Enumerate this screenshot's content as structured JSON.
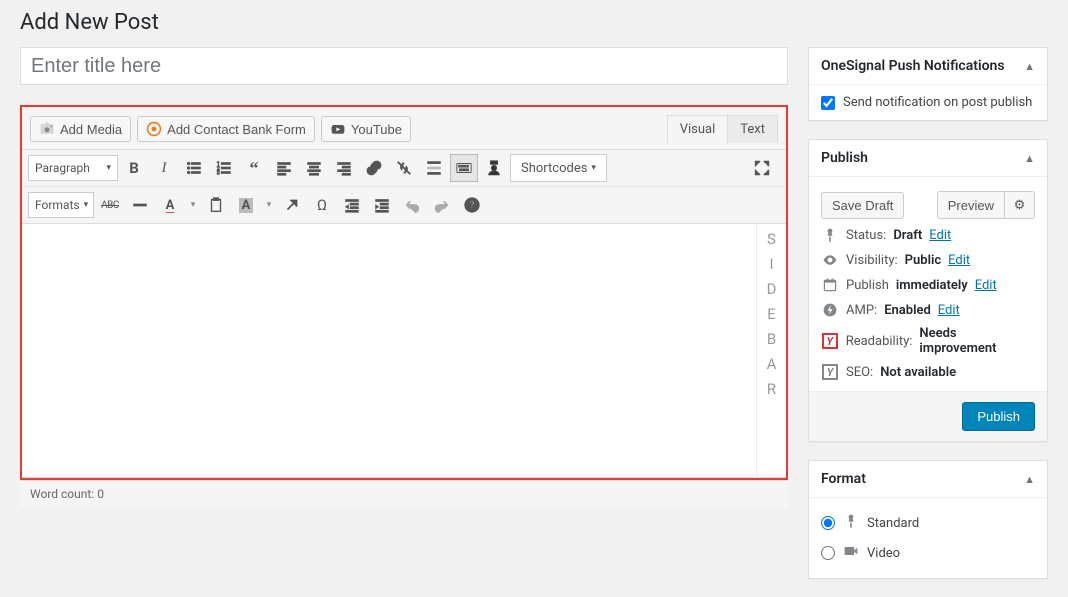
{
  "page_title": "Add New Post",
  "title_placeholder": "Enter title here",
  "media_buttons": {
    "add_media": "Add Media",
    "add_contact": "Add Contact Bank Form",
    "youtube": "YouTube"
  },
  "editor_tabs": {
    "visual": "Visual",
    "text": "Text"
  },
  "toolbar": {
    "paragraph": "Paragraph",
    "formats": "Formats",
    "shortcodes": "Shortcodes",
    "abc": "ABC"
  },
  "sidebar_strip": [
    "S",
    "I",
    "D",
    "E",
    "B",
    "A",
    "R"
  ],
  "word_count_label": "Word count:",
  "word_count_value": "0",
  "panels": {
    "onesignal": {
      "title": "OneSignal Push Notifications",
      "checkbox_label": "Send notification on post publish"
    },
    "publish": {
      "title": "Publish",
      "save_draft": "Save Draft",
      "preview": "Preview",
      "status_label": "Status:",
      "status_value": "Draft",
      "visibility_label": "Visibility:",
      "visibility_value": "Public",
      "publish_label": "Publish",
      "publish_value": "immediately",
      "amp_label": "AMP:",
      "amp_value": "Enabled",
      "readability_label": "Readability:",
      "readability_value": "Needs improvement",
      "seo_label": "SEO:",
      "seo_value": "Not available",
      "edit": "Edit",
      "publish_btn": "Publish"
    },
    "format": {
      "title": "Format",
      "standard": "Standard",
      "video": "Video"
    }
  }
}
